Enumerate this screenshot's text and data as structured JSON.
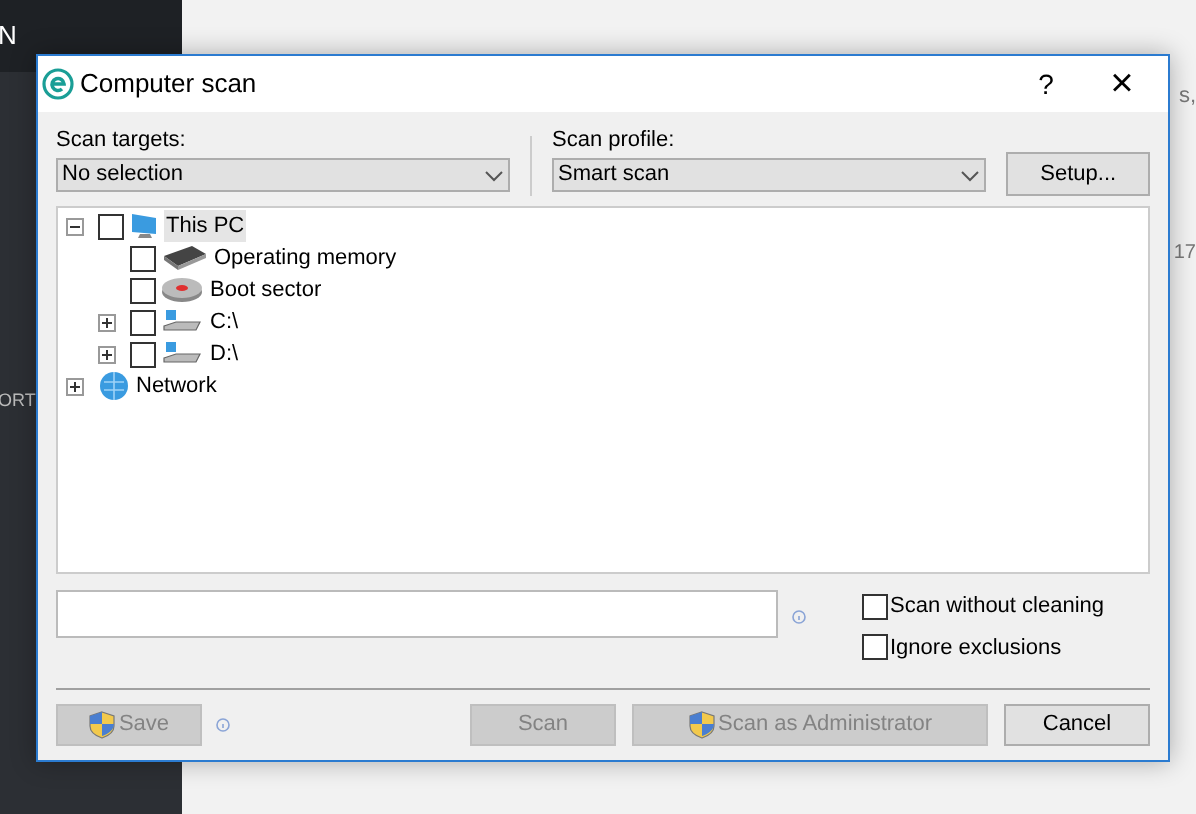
{
  "background": {
    "sidebar_top_text": "N",
    "sidebar_text": "ORT",
    "content_text_1": "s,",
    "content_text_2": "17"
  },
  "window": {
    "title": "Computer scan",
    "help": "?",
    "close": "×"
  },
  "scan_targets": {
    "label": "Scan targets:",
    "value": "No selection"
  },
  "scan_profile": {
    "label": "Scan profile:",
    "value": "Smart scan"
  },
  "setup_button": "Setup...",
  "tree": [
    {
      "label": "This PC",
      "kind": "computer",
      "checked": false,
      "expanded": true,
      "selected": true,
      "children": [
        {
          "label": "Operating memory",
          "kind": "memory",
          "checked": false,
          "selected": false
        },
        {
          "label": "Boot sector",
          "kind": "boot",
          "checked": false,
          "selected": false
        },
        {
          "label": "C:\\",
          "kind": "drive",
          "checked": false,
          "expanded": false,
          "selected": false
        },
        {
          "label": "D:\\",
          "kind": "drive",
          "checked": false,
          "expanded": false,
          "selected": false
        }
      ]
    },
    {
      "label": "Network",
      "kind": "network",
      "expanded": false,
      "selected": false
    }
  ],
  "options": [
    {
      "label": "Scan without cleaning",
      "checked": false
    },
    {
      "label": "Ignore exclusions",
      "checked": false
    }
  ],
  "buttons": [
    {
      "label": "Save",
      "shield": true,
      "disabled": true
    },
    {
      "label": "Scan",
      "shield": false,
      "disabled": true
    },
    {
      "label": "Scan as Administrator",
      "shield": true,
      "disabled": true
    },
    {
      "label": "Cancel",
      "shield": false,
      "disabled": false
    }
  ]
}
